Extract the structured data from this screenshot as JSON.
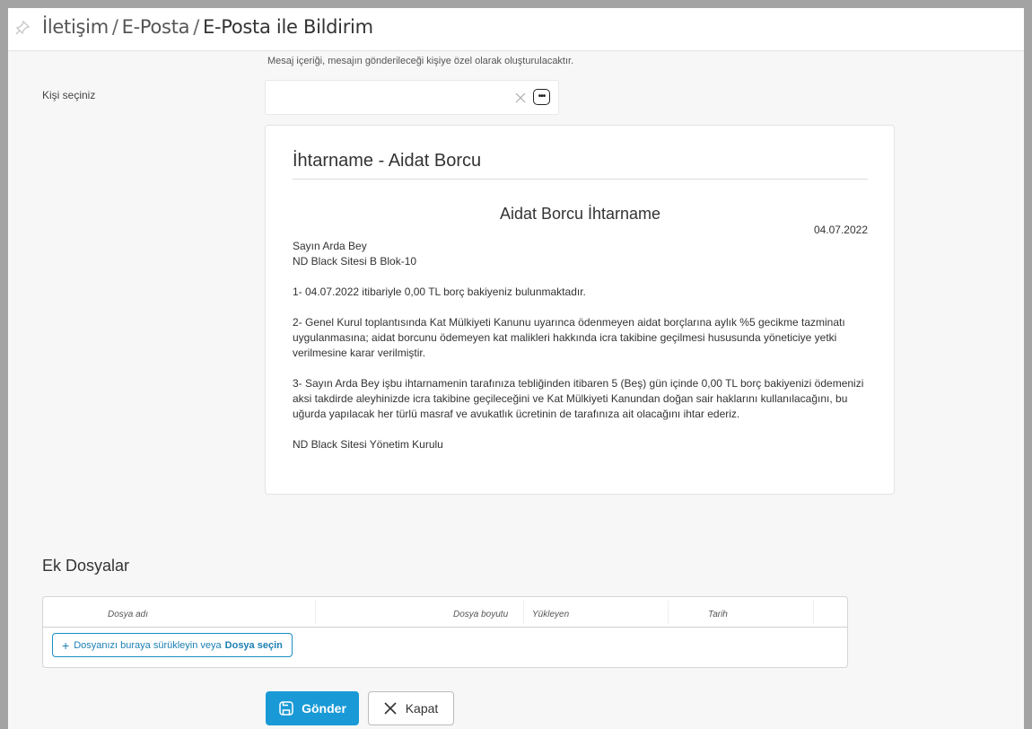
{
  "header": {
    "breadcrumb": [
      "İletişim",
      "E-Posta",
      "E-Posta ile Bildirim"
    ]
  },
  "form": {
    "hint": "Mesaj içeriği, mesajın gönderileceği kişiye özel olarak oluşturulacaktır.",
    "person_label": "Kişi seçiniz",
    "person_value": "",
    "more_label": "•••"
  },
  "preview": {
    "title": "İhtarname - Aidat Borcu",
    "doc_heading": "Aidat Borcu İhtarname",
    "date": "04.07.2022",
    "recipient": "Sayın Arda Bey",
    "address": "ND Black Sitesi B Blok-10",
    "para1": "1- 04.07.2022 itibariyle 0,00 TL borç bakiyeniz bulunmaktadır.",
    "para2": "2- Genel Kurul toplantısında Kat Mülkiyeti Kanunu uyarınca ödenmeyen aidat borçlarına aylık %5 gecikme tazminatı uygulanmasına; aidat borcunu ödemeyen kat malikleri hakkında icra takibine geçilmesi hususunda yöneticiye yetki verilmesine karar verilmiştir.",
    "para3": "3- Sayın Arda Bey işbu ihtarnamenin tarafınıza tebliğinden itibaren 5 (Beş) gün içinde 0,00 TL borç bakiyenizi ödemenizi aksi takdirde aleyhinizde icra takibine geçileceğini ve Kat Mülkiyeti Kanundan doğan sair haklarını kullanılacağını, bu uğurda yapılacak her türlü masraf ve avukatlık ücretinin de tarafınıza ait olacağını ihtar ederiz.",
    "signature": "ND Black Sitesi Yönetim Kurulu"
  },
  "attachments": {
    "title": "Ek Dosyalar",
    "columns": [
      "Dosya adı",
      "Dosya boyutu",
      "Yükleyen",
      "Tarih"
    ],
    "upload_text": "Dosyanızı buraya sürükleyin veya",
    "upload_link": "Dosya seçin"
  },
  "actions": {
    "send_label": "Gönder",
    "close_label": "Kapat"
  },
  "colors": {
    "accent": "#199ad6",
    "link": "#1a7fb3"
  }
}
